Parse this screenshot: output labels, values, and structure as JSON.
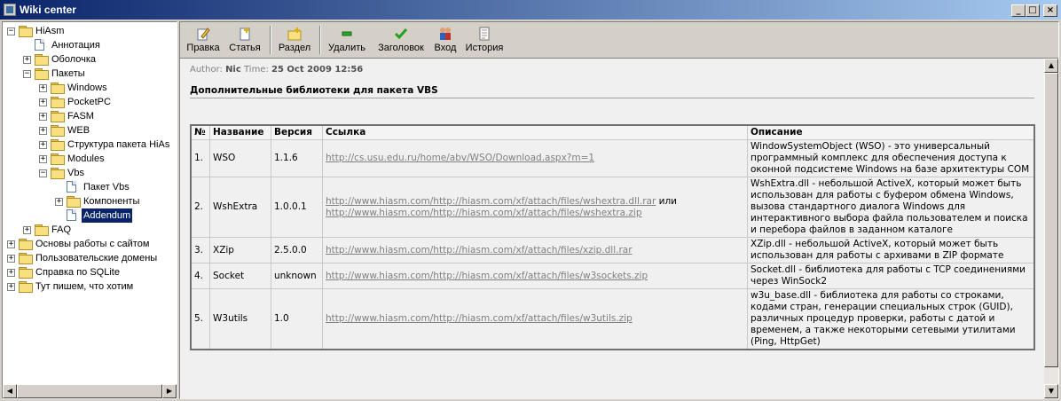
{
  "window": {
    "title": "Wiki center",
    "controls": [
      "_",
      "□",
      "×"
    ]
  },
  "tree": [
    {
      "label": "HiAsm",
      "icon": "folder-icon",
      "expander": "−",
      "level": 0
    },
    {
      "label": "Аннотация",
      "icon": "document-icon",
      "expander": "",
      "level": 1
    },
    {
      "label": "Оболочка",
      "icon": "folder-icon",
      "expander": "+",
      "level": 1
    },
    {
      "label": "Пакеты",
      "icon": "folder-icon",
      "expander": "−",
      "level": 1
    },
    {
      "label": "Windows",
      "icon": "folder-icon",
      "expander": "+",
      "level": 2
    },
    {
      "label": "PocketPC",
      "icon": "folder-icon",
      "expander": "+",
      "level": 2
    },
    {
      "label": "FASM",
      "icon": "folder-icon",
      "expander": "+",
      "level": 2
    },
    {
      "label": "WEB",
      "icon": "folder-icon",
      "expander": "+",
      "level": 2
    },
    {
      "label": "Структура пакета HiAs",
      "icon": "folder-icon",
      "expander": "+",
      "level": 2
    },
    {
      "label": "Modules",
      "icon": "folder-icon",
      "expander": "+",
      "level": 2
    },
    {
      "label": "Vbs",
      "icon": "folder-icon",
      "expander": "−",
      "level": 2
    },
    {
      "label": "Пакет Vbs",
      "icon": "document-icon",
      "expander": "",
      "level": 3
    },
    {
      "label": "Компоненты",
      "icon": "folder-icon",
      "expander": "+",
      "level": 3
    },
    {
      "label": "Addendum",
      "icon": "document-icon",
      "expander": "",
      "level": 3,
      "selected": true
    },
    {
      "label": "FAQ",
      "icon": "folder-icon",
      "expander": "+",
      "level": 1
    },
    {
      "label": "Основы работы с сайтом",
      "icon": "folder-icon",
      "expander": "+",
      "level": 0
    },
    {
      "label": "Пользовательские домены",
      "icon": "folder-icon",
      "expander": "+",
      "level": 0
    },
    {
      "label": "Справка по SQLite",
      "icon": "folder-icon",
      "expander": "+",
      "level": 0
    },
    {
      "label": "Тут пишем, что хотим",
      "icon": "folder-icon",
      "expander": "+",
      "level": 0
    }
  ],
  "toolbar": {
    "buttons": [
      {
        "label": "Правка",
        "icon": "edit-icon"
      },
      {
        "label": "Статья",
        "icon": "new-article-icon"
      },
      {
        "label": "Раздел",
        "icon": "new-section-icon"
      },
      {
        "label": "Удалить",
        "icon": "delete-icon"
      },
      {
        "label": "Заголовок",
        "icon": "checkmark-icon"
      },
      {
        "label": "Вход",
        "icon": "users-icon"
      },
      {
        "label": "История",
        "icon": "history-icon"
      }
    ]
  },
  "article": {
    "author_label": "Author:",
    "author": "Nic",
    "time_label": "Time:",
    "time": "25 Oct 2009 12:56",
    "title": "Дополнительные библиотеки для пакета VBS"
  },
  "libraries_table": {
    "headers": [
      "№",
      "Название",
      "Версия",
      "Ссылка",
      "Описание"
    ],
    "rows": [
      {
        "num": "1.",
        "name": "WSO",
        "version": "1.1.6",
        "links": [
          "http://cs.usu.edu.ru/home/abv/WSO/Download.aspx?m=1"
        ],
        "link_sep": "",
        "description": "WindowSystemObject (WSO) - это универсальный программный комплекс для обеспечения доступа к оконной подсистеме Windows на базе архитектуры COM"
      },
      {
        "num": "2.",
        "name": "WshExtra",
        "version": "1.0.0.1",
        "links": [
          "http://www.hiasm.com/http://hiasm.com/xf/attach/files/wshextra.dll.rar",
          "http://www.hiasm.com/http://hiasm.com/xf/attach/files/wshextra.zip"
        ],
        "link_sep": " или ",
        "description": "WshExtra.dll - небольшой ActiveX, который может быть использован для работы с буфером обмена Windows, вызова стандартного диалога Windows для интерактивного выбора файла пользователем и поиска и перебора файлов в заданном каталоге"
      },
      {
        "num": "3.",
        "name": "XZip",
        "version": "2.5.0.0",
        "links": [
          "http://www.hiasm.com/http://hiasm.com/xf/attach/files/xzip.dll.rar"
        ],
        "link_sep": "",
        "description": "XZip.dll - небольшой ActiveX, который может быть использован для работы с архивами в ZIP формате"
      },
      {
        "num": "4.",
        "name": "Socket",
        "version": "unknown",
        "links": [
          "http://www.hiasm.com/http://hiasm.com/xf/attach/files/w3sockets.zip"
        ],
        "link_sep": "",
        "description": "Socket.dll - библиотека для работы с TCP соединениями через WinSock2"
      },
      {
        "num": "5.",
        "name": "W3utils",
        "version": "1.0",
        "links": [
          "http://www.hiasm.com/http://hiasm.com/xf/attach/files/w3utils.zip"
        ],
        "link_sep": "",
        "description": "w3u_base.dll - библиотека для работы со строками, кодами стран, генерации специальных строк (GUID), различных процедур проверки, работы с датой и временем, а также некоторыми сетевыми утилитами (Ping, HttpGet)"
      }
    ]
  },
  "scrollbar_arrows": {
    "left": "◀",
    "right": "▶",
    "up": "▲",
    "down": "▼"
  }
}
